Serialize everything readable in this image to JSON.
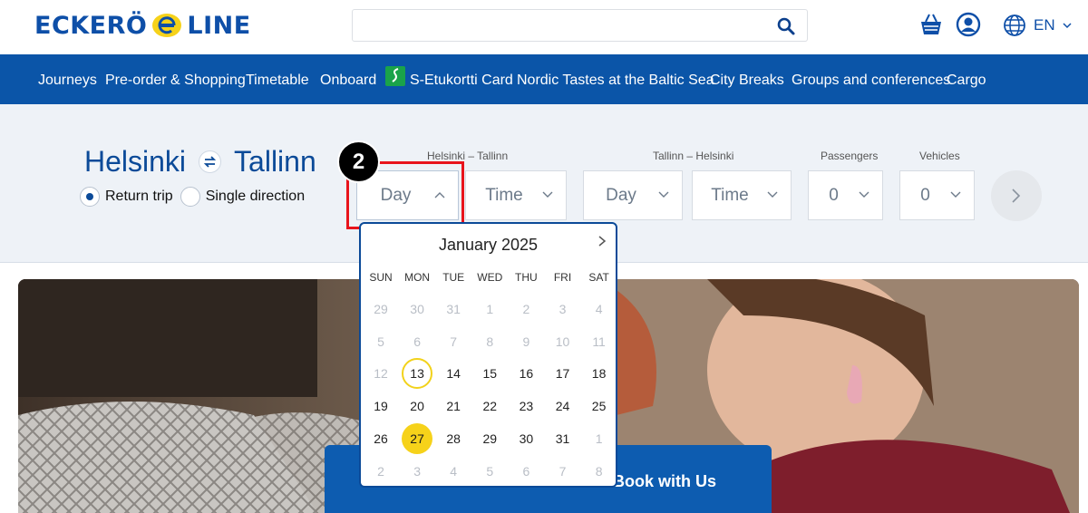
{
  "brand": {
    "left": "ECKERÖ",
    "right": "LINE"
  },
  "search": {
    "placeholder": ""
  },
  "header": {
    "language": "EN"
  },
  "nav": [
    {
      "label": "Journeys"
    },
    {
      "label": "Pre-order & Shopping"
    },
    {
      "label": "Timetable"
    },
    {
      "label": "Onboard"
    },
    {
      "label": "S-Etukortti Card"
    },
    {
      "label": "Nordic Tastes at the Baltic Sea"
    },
    {
      "label": "City Breaks"
    },
    {
      "label": "Groups and conferences"
    },
    {
      "label": "Cargo"
    }
  ],
  "booking": {
    "from": "Helsinki",
    "to": "Tallinn",
    "trip_types": [
      {
        "label": "Return trip",
        "selected": true
      },
      {
        "label": "Single direction",
        "selected": false
      }
    ],
    "outbound_label": "Helsinki – Tallinn",
    "return_label": "Tallinn – Helsinki",
    "passengers_label": "Passengers",
    "vehicles_label": "Vehicles",
    "out_day": "Day",
    "out_time": "Time",
    "ret_day": "Day",
    "ret_time": "Time",
    "passengers": "0",
    "vehicles": "0"
  },
  "step_marker": "2",
  "calendar": {
    "month": "January 2025",
    "weekdays": [
      "SUN",
      "MON",
      "TUE",
      "WED",
      "THU",
      "FRI",
      "SAT"
    ],
    "weeks": [
      [
        "29",
        "30",
        "31",
        "1",
        "2",
        "3",
        "4"
      ],
      [
        "5",
        "6",
        "7",
        "8",
        "9",
        "10",
        "11"
      ],
      [
        "12",
        "13",
        "14",
        "15",
        "16",
        "17",
        "18"
      ],
      [
        "19",
        "20",
        "21",
        "22",
        "23",
        "24",
        "25"
      ],
      [
        "26",
        "27",
        "28",
        "29",
        "30",
        "31",
        "1"
      ],
      [
        "2",
        "3",
        "4",
        "5",
        "6",
        "7",
        "8"
      ]
    ],
    "today": "13",
    "selected": "27"
  },
  "cta": {
    "label": "Book with Us"
  },
  "colors": {
    "primary": "#0b55a8",
    "highlight": "#e8141b",
    "selected_day": "#f6d21a"
  }
}
